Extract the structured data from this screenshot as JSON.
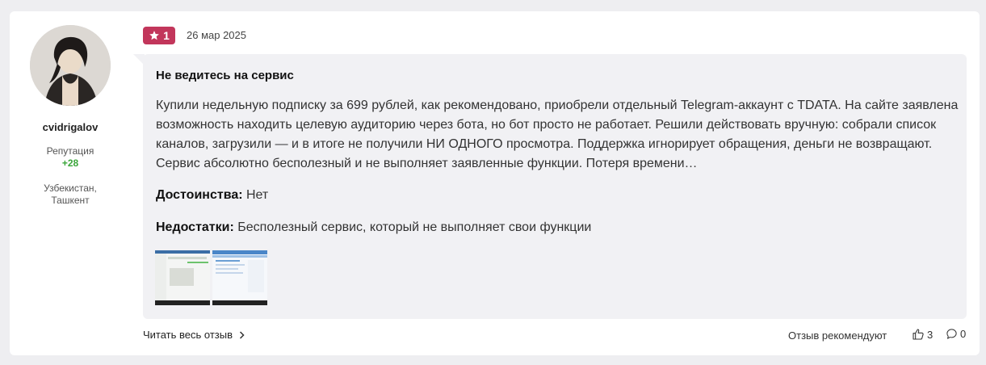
{
  "author": {
    "username": "cvidrigalov",
    "reputation_label": "Репутация",
    "reputation_value": "+28",
    "location_line1": "Узбекистан,",
    "location_line2": "Ташкент"
  },
  "review": {
    "rating": "1",
    "date": "26 мар 2025",
    "title": "Не ведитесь на сервис",
    "body": "Купили недельную подписку за 699 рублей, как рекомендовано, приобрели отдельный Telegram-аккаунт с TDATA. На сайте заявлена возможность находить целевую аудиторию через бота, но бот просто не работает. Решили действовать вручную: собрали список каналов, загрузили — и в итоге не получили НИ ОДНОГО просмотра. Поддержка игнорирует обращения, деньги не возвращают. Сервис абсолютно бесполезный и не выполняет заявленные функции. Потеря времени…",
    "pros_label": "Достоинства:",
    "pros_text": " Нет",
    "cons_label": "Недостатки:",
    "cons_text": " Бесполезный сервис, который не выполняет свои функции"
  },
  "footer": {
    "read_more": "Читать весь отзыв",
    "recommended": "Отзыв рекомендуют",
    "likes": "3",
    "comments": "0"
  },
  "colors": {
    "badge": "#c2365b",
    "reputation": "#3aa63a",
    "bubble": "#f1f1f4"
  },
  "icons": [
    "star-icon",
    "chevron-right-icon",
    "thumbs-up-icon",
    "comment-icon"
  ]
}
